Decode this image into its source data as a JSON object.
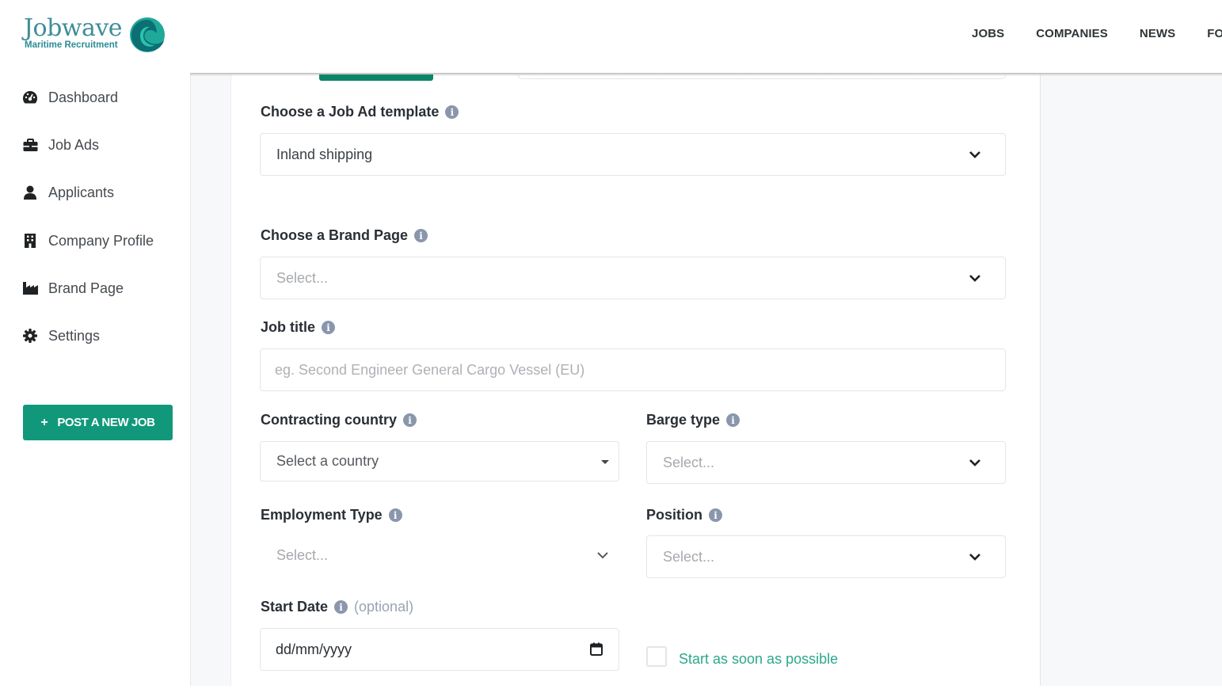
{
  "brand": {
    "name": "Jobwave",
    "tagline": "Maritime Recruitment",
    "accent_color": "#11987a",
    "logo_icon": "wave-icon"
  },
  "topnav": {
    "items": [
      {
        "label": "JOBS"
      },
      {
        "label": "COMPANIES"
      },
      {
        "label": "NEWS"
      },
      {
        "label": "FO"
      }
    ]
  },
  "sidebar": {
    "items": [
      {
        "label": "Dashboard",
        "icon": "tachometer-icon"
      },
      {
        "label": "Job Ads",
        "icon": "briefcase-icon"
      },
      {
        "label": "Applicants",
        "icon": "user-icon"
      },
      {
        "label": "Company Profile",
        "icon": "building-icon"
      },
      {
        "label": "Brand Page",
        "icon": "industry-icon"
      },
      {
        "label": "Settings",
        "icon": "gear-icon"
      }
    ],
    "post_button": {
      "icon": "+",
      "label": "POST A NEW JOB"
    }
  },
  "form": {
    "job_ad_template": {
      "label": "Choose a Job Ad template",
      "value": "Inland shipping"
    },
    "brand_page": {
      "label": "Choose a Brand Page",
      "placeholder": "Select..."
    },
    "job_title": {
      "label": "Job title",
      "placeholder": "eg. Second Engineer General Cargo Vessel (EU)",
      "value": ""
    },
    "contracting_country": {
      "label": "Contracting country",
      "placeholder": "Select a country"
    },
    "barge_type": {
      "label": "Barge type",
      "placeholder": "Select..."
    },
    "employment_type": {
      "label": "Employment Type",
      "placeholder": "Select..."
    },
    "position": {
      "label": "Position",
      "placeholder": "Select..."
    },
    "start_date": {
      "label": "Start Date",
      "optional": "(optional)",
      "placeholder": "dd/mm/yyyy"
    },
    "asap": {
      "label": "Start as soon as possible",
      "checked": false
    }
  }
}
